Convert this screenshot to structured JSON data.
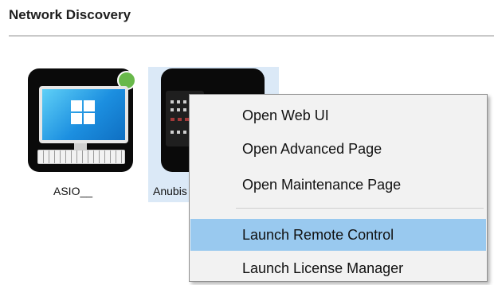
{
  "section": {
    "title": "Network Discovery"
  },
  "devices": [
    {
      "label": "ASIO__",
      "icon": "windows-computer-icon",
      "status": "online",
      "status_color": "#68b84a"
    },
    {
      "label": "Anubis",
      "icon": "audio-mixer-icon",
      "selected": true
    }
  ],
  "context_menu": {
    "items": [
      {
        "label": "Open Web UI"
      },
      {
        "label": "Open Advanced Page"
      },
      {
        "label": "Open Maintenance Page"
      },
      {
        "label": "Launch Remote Control",
        "highlighted": true
      },
      {
        "label": "Launch License Manager"
      }
    ]
  },
  "colors": {
    "highlight": "#99c9ef",
    "selection": "#dbe9f7",
    "accent": "#1c8fe0"
  }
}
